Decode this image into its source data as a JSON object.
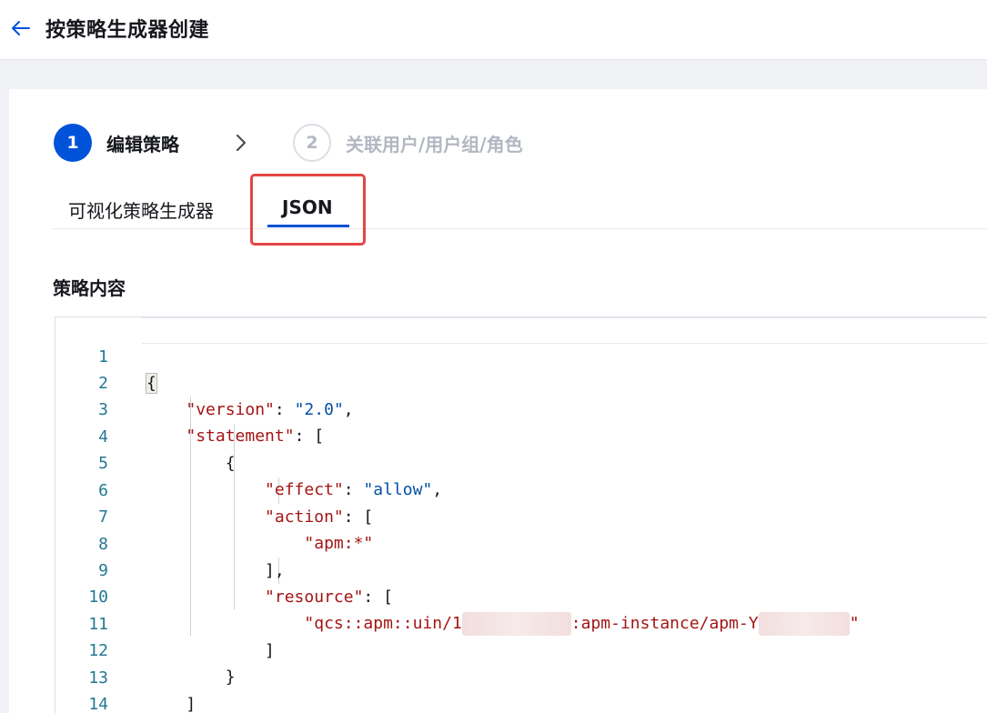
{
  "header": {
    "title": "按策略生成器创建"
  },
  "steps": [
    {
      "number": "1",
      "label": "编辑策略",
      "state": "active"
    },
    {
      "number": "2",
      "label": "关联用户/用户组/角色",
      "state": "inactive"
    }
  ],
  "tabs": [
    {
      "label": "可视化策略生成器",
      "active": false
    },
    {
      "label": "JSON",
      "active": true
    }
  ],
  "section": {
    "title": "策略内容"
  },
  "editor": {
    "line_numbers": [
      "1",
      "2",
      "3",
      "4",
      "5",
      "6",
      "7",
      "8",
      "9",
      "10",
      "11",
      "12",
      "13",
      "14"
    ],
    "lines": {
      "l1": "{",
      "l2_key": "\"version\"",
      "l2_sep": ": ",
      "l2_val": "\"2.0\"",
      "l2_end": ",",
      "l3_key": "\"statement\"",
      "l3_end": ": [",
      "l4": "{",
      "l5_key": "\"effect\"",
      "l5_sep": ": ",
      "l5_val": "\"allow\"",
      "l5_end": ",",
      "l6_key": "\"action\"",
      "l6_end": ": [",
      "l7_val": "\"apm:*\"",
      "l8": "],",
      "l9_key": "\"resource\"",
      "l9_end": ": [",
      "l10_a": "\"qcs::apm::uin/1",
      "l10_b": ":apm-instance/apm-Y",
      "l10_c": "\"",
      "l11": "]",
      "l12": "}",
      "l13": "]",
      "l14": "}"
    }
  },
  "colors": {
    "primary": "#0052d9",
    "highlight_border": "#e54545",
    "json_key": "#a31515",
    "json_string": "#0451a5",
    "line_number": "#237893"
  }
}
